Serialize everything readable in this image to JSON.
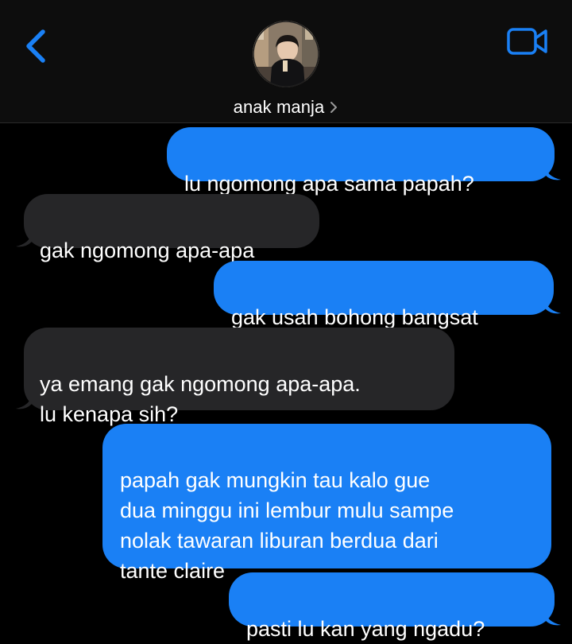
{
  "header": {
    "back_icon": "chevron-left-icon",
    "video_icon": "video-camera-icon",
    "contact_name": "anak manja",
    "name_chevron_icon": "chevron-right-icon",
    "accent_color": "#1a80f5"
  },
  "messages": [
    {
      "direction": "sent",
      "text": "lu ngomong apa sama papah?"
    },
    {
      "direction": "received",
      "text": "gak ngomong apa-apa"
    },
    {
      "direction": "sent",
      "text": "gak usah bohong bangsat"
    },
    {
      "direction": "received",
      "text": "ya emang gak ngomong apa-apa.\nlu kenapa sih?"
    },
    {
      "direction": "sent",
      "text": "papah gak mungkin tau kalo gue\ndua minggu ini lembur mulu sampe\nnolak tawaran liburan berdua dari\ntante claire"
    },
    {
      "direction": "sent",
      "text": "pasti lu kan yang ngadu?"
    }
  ],
  "colors": {
    "sent_bubble": "#1a80f5",
    "received_bubble": "#262628",
    "background": "#000000"
  }
}
